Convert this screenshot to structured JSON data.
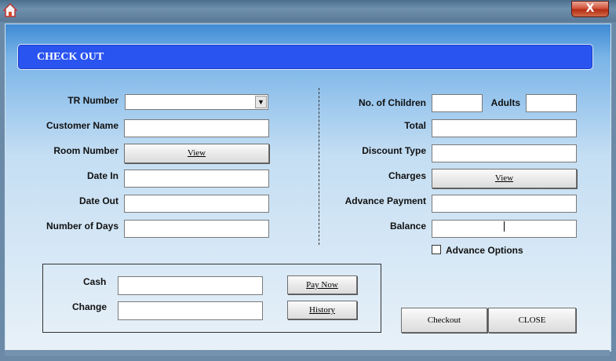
{
  "window": {
    "close_glyph": "X"
  },
  "header": {
    "title": "CHECK OUT"
  },
  "left": {
    "tr_number_label": "TR Number",
    "customer_name_label": "Customer Name",
    "room_number_label": "Room Number",
    "room_view_label": "View",
    "date_in_label": "Date In",
    "date_out_label": "Date Out",
    "number_of_days_label": "Number of Days"
  },
  "right": {
    "children_label": "No. of Children",
    "adults_label": "Adults",
    "total_label": "Total",
    "discount_type_label": "Discount Type",
    "charges_label": "Charges",
    "charges_view_label": "View",
    "advance_payment_label": "Advance Payment",
    "balance_label": "Balance",
    "advance_options_label": "Advance Options"
  },
  "payment": {
    "cash_label": "Cash",
    "change_label": "Change",
    "pay_now_label": "Pay Now",
    "history_label": "History"
  },
  "actions": {
    "checkout_label": "Checkout",
    "close_label": "CLOSE"
  }
}
